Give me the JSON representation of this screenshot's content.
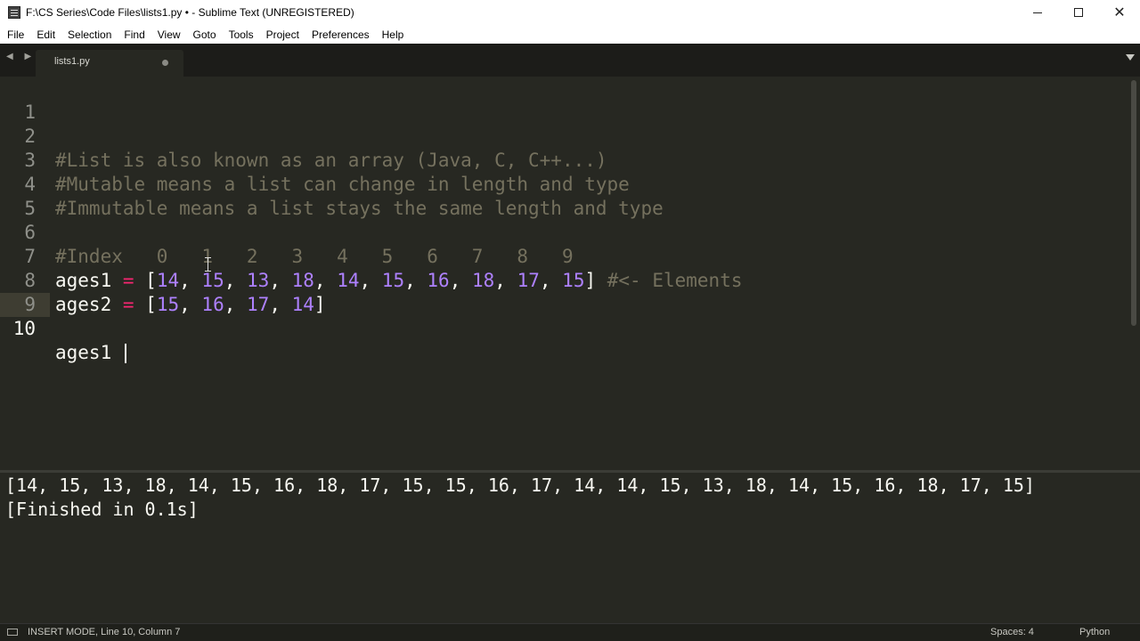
{
  "window": {
    "title": "F:\\CS Series\\Code Files\\lists1.py • - Sublime Text (UNREGISTERED)",
    "minimize_label": "",
    "close_label": "✕"
  },
  "menu": {
    "items": [
      "File",
      "Edit",
      "Selection",
      "Find",
      "View",
      "Goto",
      "Tools",
      "Project",
      "Preferences",
      "Help"
    ]
  },
  "tabs": {
    "nav_arrows": "◀ ▶",
    "active": {
      "label": "lists1.py",
      "modified": true
    }
  },
  "editor": {
    "lines": [
      {
        "num": "1",
        "code": ""
      },
      {
        "num": "2",
        "code": "#List is also known as an array (Java, C, C++...)"
      },
      {
        "num": "3",
        "code": "#Mutable means a list can change in length and type"
      },
      {
        "num": "4",
        "code": "#Immutable means a list stays the same length and type"
      },
      {
        "num": "5",
        "code": ""
      },
      {
        "num": "6",
        "code": "#Index   0   1   2   3   4   5   6   7   8   9"
      },
      {
        "num": "7",
        "var": "ages1",
        "op": "=",
        "values": [
          "14",
          "15",
          "13",
          "18",
          "14",
          "15",
          "16",
          "18",
          "17",
          "15"
        ],
        "comment": "#<- Elements"
      },
      {
        "num": "8",
        "var": "ages2",
        "op": "=",
        "values": [
          "15",
          "16",
          "17",
          "14"
        ]
      },
      {
        "num": "9",
        "code": ""
      },
      {
        "num": "10",
        "code": "ages1 "
      }
    ],
    "active_line": 10
  },
  "output": {
    "lines": [
      "[14, 15, 13, 18, 14, 15, 16, 18, 17, 15, 15, 16, 17, 14, 14, 15, 13, 18, 14, 15, 16, 18, 17, 15]",
      "[Finished in 0.1s]"
    ]
  },
  "status": {
    "left": "INSERT MODE, Line 10, Column 7",
    "spaces": "Spaces: 4",
    "syntax": "Python"
  },
  "colors": {
    "editor_bg": "#272822",
    "comment": "#75715e",
    "number": "#ae81ff",
    "operator": "#f92672",
    "text": "#f8f8f2"
  }
}
